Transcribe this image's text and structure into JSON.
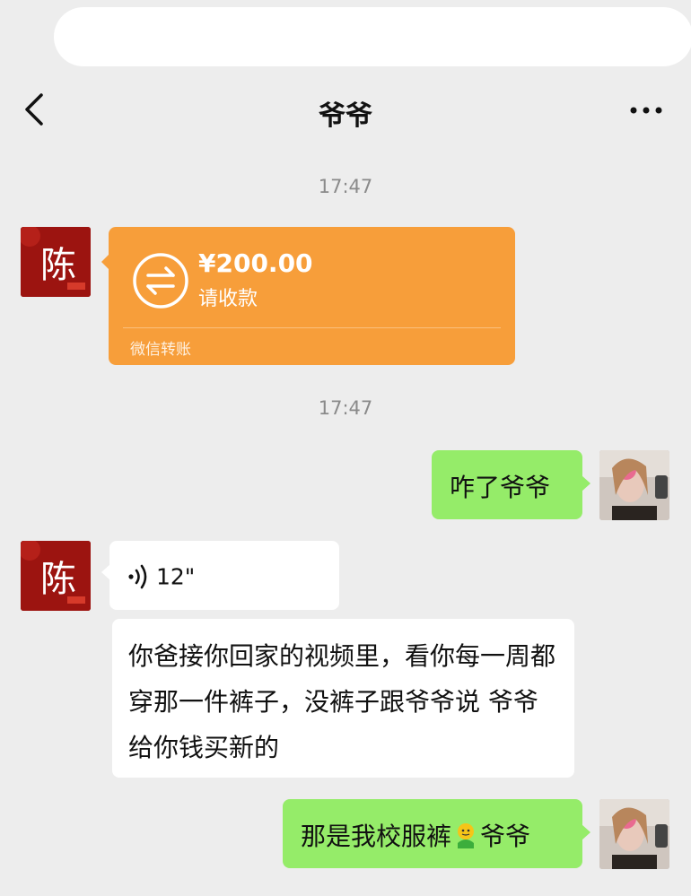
{
  "header": {
    "title": "爷爷"
  },
  "timestamps": [
    "17:47",
    "17:47"
  ],
  "transfer": {
    "amount": "¥200.00",
    "status": "请收款",
    "label": "微信转账",
    "color": "#f79e3a"
  },
  "messages": {
    "sent_1": "咋了爷爷",
    "voice_length": "12\"",
    "received_text": "你爸接你回家的视频里，看你每一周都穿那一件裤子，没裤子跟爷爷说 爷爷给你钱买新的",
    "sent_2_before": "那是我校服裤",
    "sent_2_after": "爷爷"
  },
  "avatars": {
    "left_char": "陈"
  },
  "colors": {
    "green_bubble": "#95ec69",
    "background": "#ededed"
  },
  "icons": [
    "back-arrow-icon",
    "more-dots-icon",
    "transfer-arrows-icon",
    "voice-wave-icon",
    "emoji-icon"
  ]
}
